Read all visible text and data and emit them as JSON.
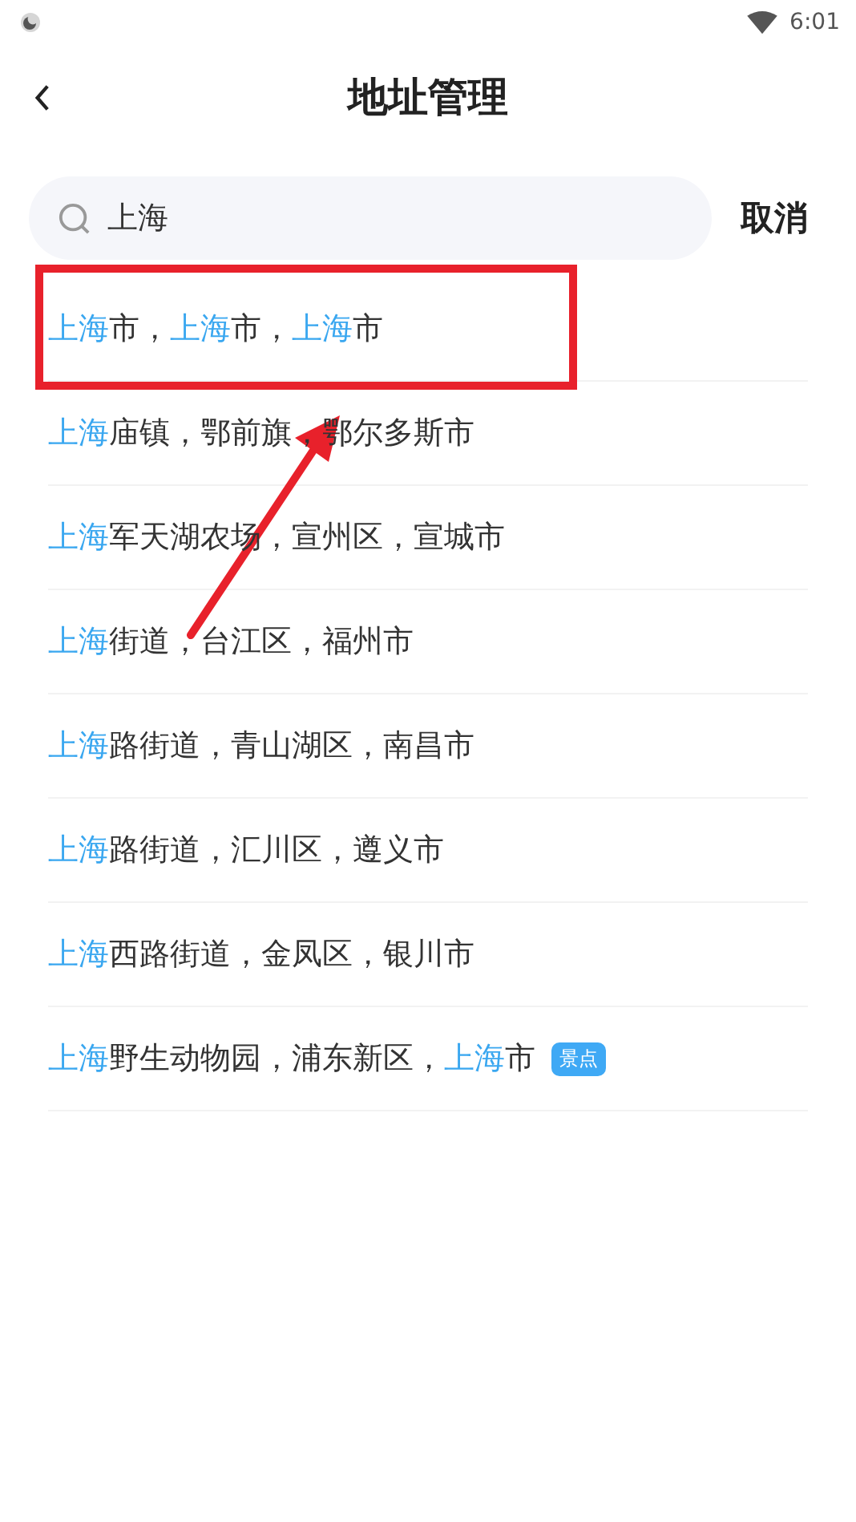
{
  "status_bar": {
    "time": "6:01"
  },
  "header": {
    "title": "地址管理"
  },
  "search": {
    "value": "上海",
    "cancel": "取消"
  },
  "results": [
    {
      "callout": true,
      "parts": [
        {
          "text": "上海",
          "match": true
        },
        {
          "text": "市，",
          "match": false
        },
        {
          "text": "上海",
          "match": true
        },
        {
          "text": "市，",
          "match": false
        },
        {
          "text": "上海",
          "match": true
        },
        {
          "text": "市",
          "match": false
        }
      ]
    },
    {
      "callout": false,
      "parts": [
        {
          "text": "上海",
          "match": true
        },
        {
          "text": "庙镇，鄂前旗，鄂尔多斯市",
          "match": false
        }
      ]
    },
    {
      "callout": false,
      "parts": [
        {
          "text": "上海",
          "match": true
        },
        {
          "text": "军天湖农场，宣州区，宣城市",
          "match": false
        }
      ]
    },
    {
      "callout": false,
      "parts": [
        {
          "text": "上海",
          "match": true
        },
        {
          "text": "街道，台江区，福州市",
          "match": false
        }
      ]
    },
    {
      "callout": false,
      "parts": [
        {
          "text": "上海",
          "match": true
        },
        {
          "text": "路街道，青山湖区，南昌市",
          "match": false
        }
      ]
    },
    {
      "callout": false,
      "parts": [
        {
          "text": "上海",
          "match": true
        },
        {
          "text": "路街道，汇川区，遵义市",
          "match": false
        }
      ]
    },
    {
      "callout": false,
      "parts": [
        {
          "text": "上海",
          "match": true
        },
        {
          "text": "西路街道，金凤区，银川市",
          "match": false
        }
      ]
    },
    {
      "callout": false,
      "parts": [
        {
          "text": "上海",
          "match": true
        },
        {
          "text": "野生动物园，浦东新区，",
          "match": false
        },
        {
          "text": "上海",
          "match": true
        },
        {
          "text": "市",
          "match": false
        }
      ],
      "tag": "景点"
    }
  ]
}
